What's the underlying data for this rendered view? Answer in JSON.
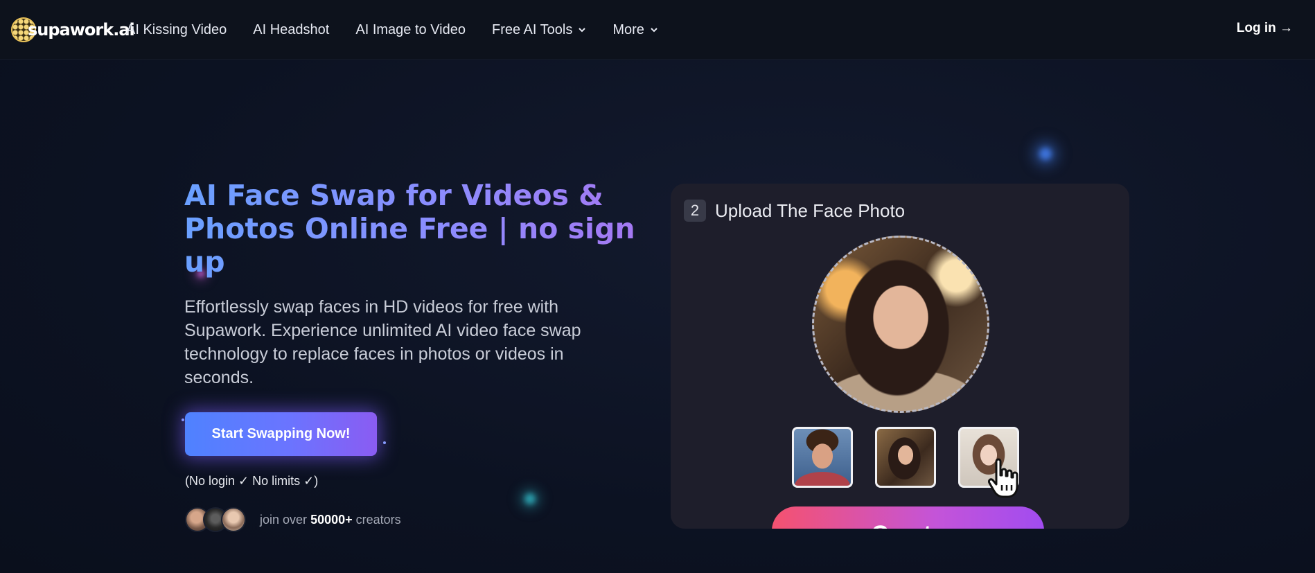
{
  "nav": {
    "logo_text": "supawork.ai",
    "links": [
      {
        "label": "AI Kissing Video",
        "has_dropdown": false
      },
      {
        "label": "AI Headshot",
        "has_dropdown": false
      },
      {
        "label": "AI Image to Video",
        "has_dropdown": false
      },
      {
        "label": "Free AI Tools",
        "has_dropdown": true
      },
      {
        "label": "More",
        "has_dropdown": true
      }
    ],
    "login_label": "Log in →"
  },
  "hero": {
    "title": "AI Face Swap for Videos & Photos Online Free | no sign up",
    "subtitle": "Effortlessly swap faces in HD videos for free with Supawork. Experience unlimited AI video face swap technology to replace faces in photos or videos in seconds.",
    "cta_label": "Start Swapping Now!",
    "cta_note": "(No login ✓ No limits ✓)",
    "creators_prefix": "join over",
    "creators_count": "50000+",
    "creators_suffix": "creators"
  },
  "upload_card": {
    "step_number": "2",
    "step_title": "Upload The Face Photo",
    "create_label": "Create"
  },
  "colors": {
    "background": "#0c1222",
    "nav_bg": "#0d121c",
    "title_gradient_start": "#6aa0ff",
    "title_gradient_end": "#a578f2",
    "cta_gradient_start": "#4f82ff",
    "cta_gradient_end": "#8a5cf2",
    "card_bg": "#1e1e2b",
    "create_gradient_start": "#f5526f",
    "create_gradient_end": "#a14cf0"
  }
}
